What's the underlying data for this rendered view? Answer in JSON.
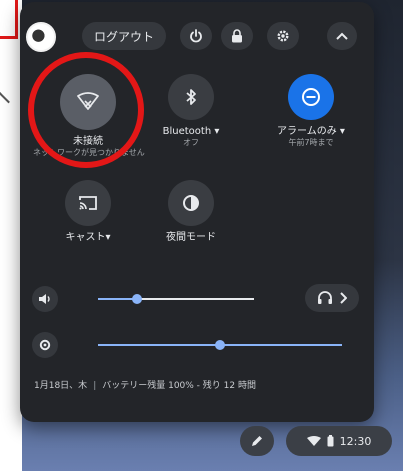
{
  "header": {
    "logout_label": "ログアウト"
  },
  "toggles": [
    {
      "label": "未接続",
      "sub": "ネットワークが見つかりません",
      "icon": "wifi-off-icon",
      "active": false
    },
    {
      "label": "Bluetooth ▾",
      "sub": "オフ",
      "icon": "bluetooth-icon",
      "active": false
    },
    {
      "label": "アラームのみ ▾",
      "sub": "午前7時まで",
      "icon": "do-not-disturb-icon",
      "active": true
    },
    {
      "label": "キャスト▾",
      "sub": "",
      "icon": "cast-icon",
      "active": false
    },
    {
      "label": "夜間モード",
      "sub": "",
      "icon": "night-light-icon",
      "active": false
    }
  ],
  "sliders": {
    "volume_level": 0.25,
    "brightness_level": 0.5
  },
  "status": {
    "date": "1月18日、木",
    "battery": "バッテリー残量 100% - 残り 12 時間"
  },
  "shelf": {
    "time": "12:30"
  },
  "colors": {
    "accent": "#1a73e8",
    "slider": "#8ab4f8",
    "panel": "#232529",
    "annotation": "#e31717"
  }
}
